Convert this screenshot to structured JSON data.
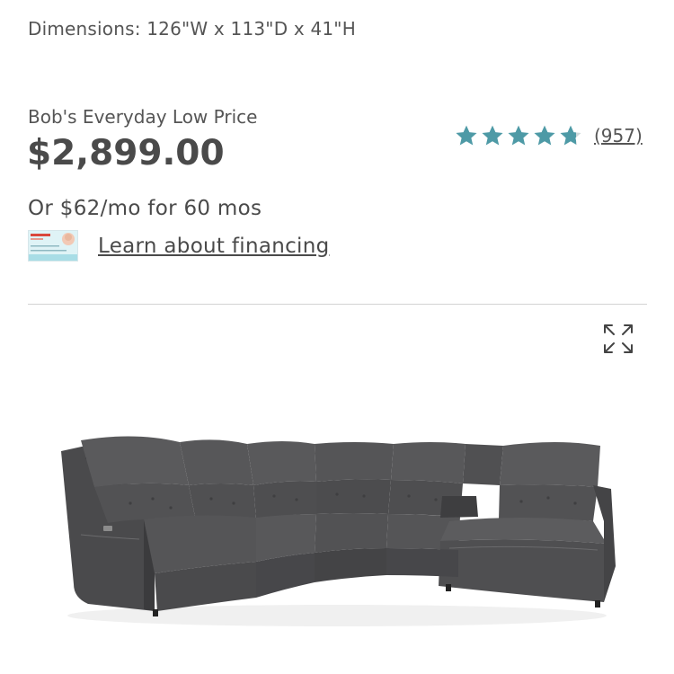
{
  "product": {
    "dimensions": "Dimensions: 126\"W x 113\"D x 41\"H",
    "price_label": "Bob's Everyday Low Price",
    "price": "$2,899.00",
    "monthly_offer": "Or $62/mo for 60 mos",
    "financing_link": "Learn about financing"
  },
  "rating": {
    "stars": 4.8,
    "max_stars": 5,
    "review_count": "(957)",
    "star_color": "#4e9aa6"
  },
  "gallery": {
    "expand_icon": "expand-icon",
    "image": "sectional-sofa-image"
  }
}
